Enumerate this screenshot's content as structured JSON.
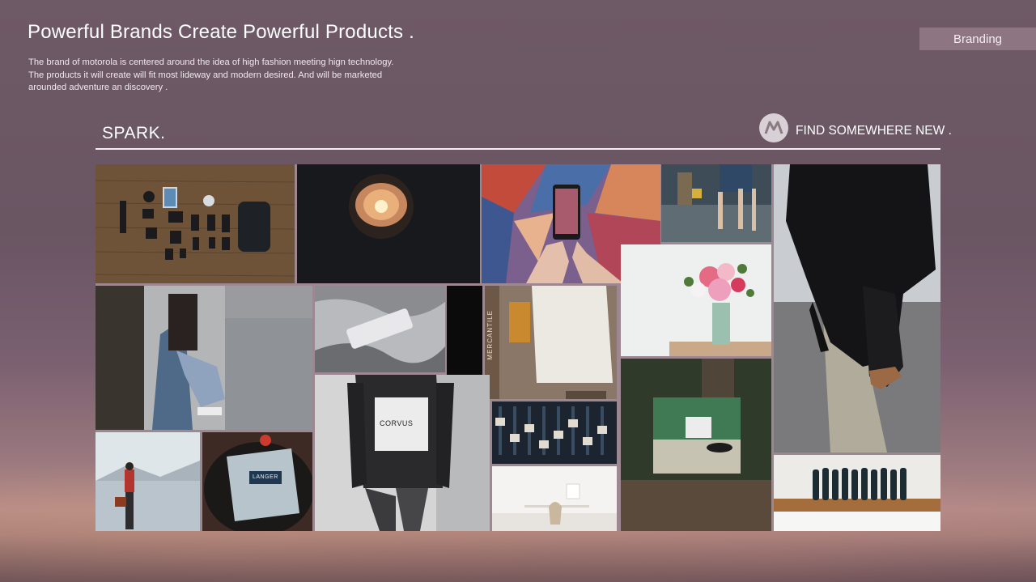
{
  "page": {
    "headline": "Powerful Brands Create Powerful Products .",
    "description": "The brand of motorola is centered around the idea of high fashion meeting hign technology.  The products it will create will fit most lideway and modern desired. And will be marketed arounded adventure an discovery .",
    "section_tag": "Branding"
  },
  "moodboard": {
    "title": "SPARK.",
    "tagline": "FIND SOMEWHERE NEW .",
    "logo_icon": "motorola-logo-icon",
    "image_labels": {
      "bag_tag": "MERCANTILE",
      "shirt_text": "CORVUS",
      "pouch_text": "LANGER"
    }
  }
}
